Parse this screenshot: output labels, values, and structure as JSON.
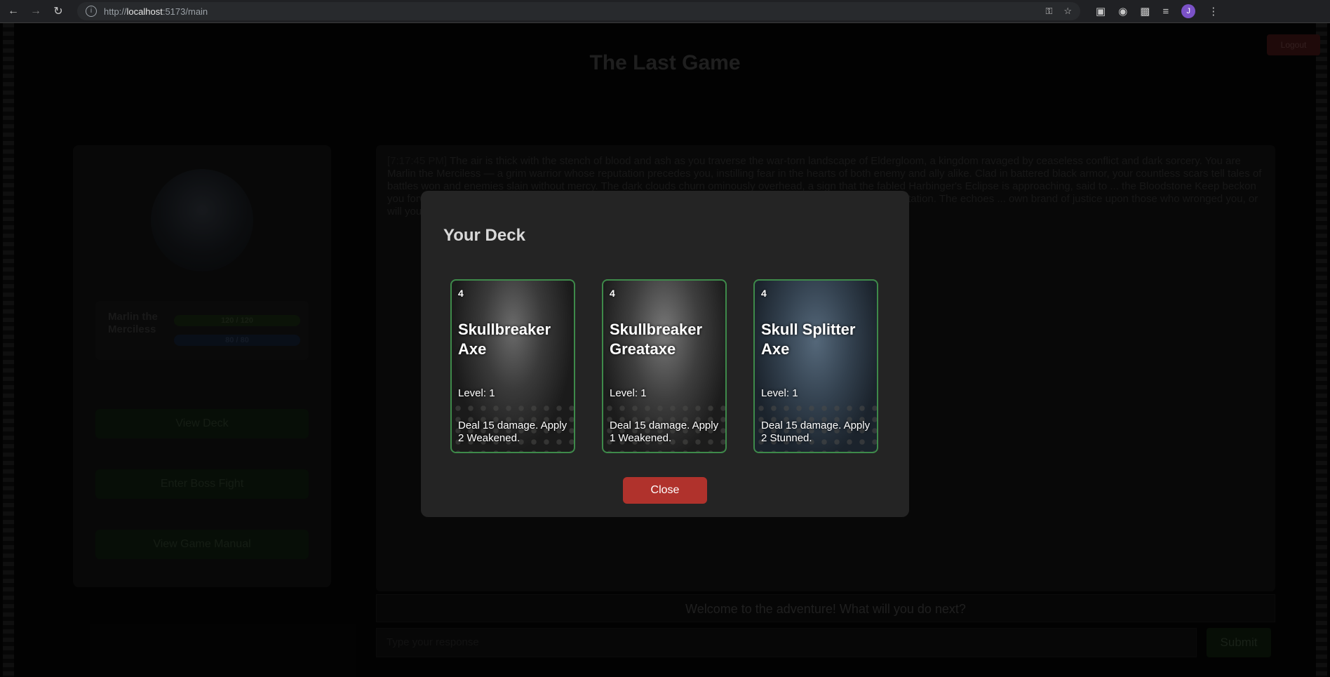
{
  "browser": {
    "url_prefix": "http://",
    "url_host": "localhost",
    "url_path": ":5173/main"
  },
  "header": {
    "title": "The Last Game",
    "logout_label": "Logout"
  },
  "player": {
    "name": "Marlin the Merciless",
    "hp_text": "120 / 120",
    "mp_text": "80 / 80"
  },
  "sidebar": {
    "buttons": [
      {
        "label": "View Deck"
      },
      {
        "label": "Enter Boss Fight"
      },
      {
        "label": "View Game Manual"
      }
    ]
  },
  "story": {
    "timestamp": "[7:17:45 PM]",
    "text": "The air is thick with the stench of blood and ash as you traverse the war-torn landscape of Eldergloom, a kingdom ravaged by ceaseless conflict and dark sorcery. You are Marlin the Merciless — a grim warrior whose reputation precedes you, instilling fear in the hearts of both enemy and ally alike. Clad in battered black armor, your countless scars tell tales of battles won and enemies slain without mercy. The dark clouds churn ominously overhead, a sign that the fabled Harbinger's Eclipse is approaching, said to ... the Bloodstone Keep beckon you forward — a relic capable of shifting the tide ... who you can trust as allies and who to cut down without hesitation. The echoes ... own brand of justice upon those who wronged you, or will you discover"
  },
  "prompt": {
    "welcome": "Welcome to the adventure! What will you do next?",
    "input_placeholder": "Type your response",
    "submit_label": "Submit"
  },
  "modal": {
    "title": "Your Deck",
    "close_label": "Close",
    "cards": [
      {
        "cost": "4",
        "name": "Skullbreaker Axe",
        "level": "Level: 1",
        "effect": "Deal 15 damage. Apply 2 Weakened."
      },
      {
        "cost": "4",
        "name": "Skullbreaker Greataxe",
        "level": "Level: 1",
        "effect": "Deal 15 damage. Apply 1 Weakened."
      },
      {
        "cost": "4",
        "name": "Skull Splitter Axe",
        "level": "Level: 1",
        "effect": "Deal 15 damage. Apply 2 Stunned."
      }
    ]
  },
  "colors": {
    "card_border": "#3e8a4a",
    "close_button": "#b0322c",
    "modal_bg": "#242424"
  }
}
